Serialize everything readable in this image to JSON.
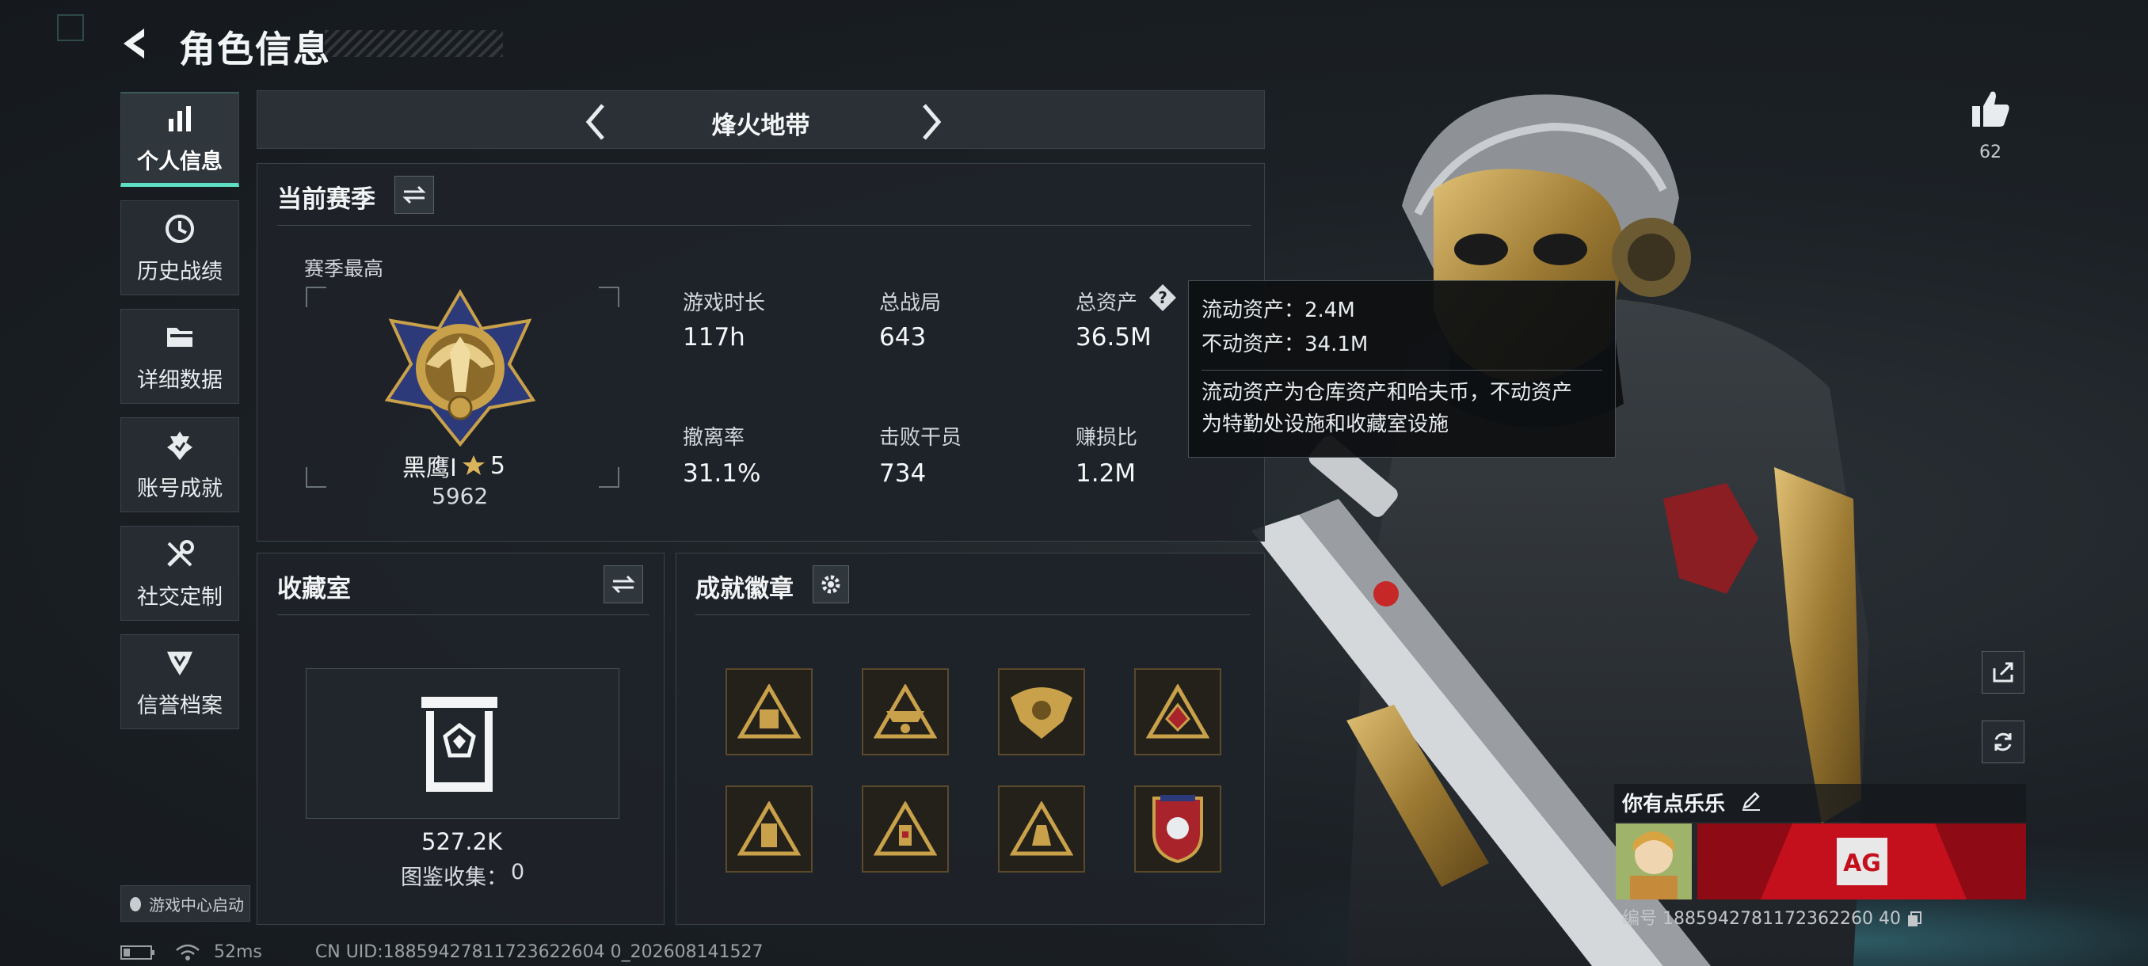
{
  "header": {
    "title": "角色信息"
  },
  "nav": {
    "items": [
      {
        "label": "个人信息",
        "icon": "bar-chart-icon",
        "active": true
      },
      {
        "label": "历史战绩",
        "icon": "history-clock-icon",
        "active": false
      },
      {
        "label": "详细数据",
        "icon": "folder-icon",
        "active": false
      },
      {
        "label": "账号成就",
        "icon": "achievement-icon",
        "active": false
      },
      {
        "label": "社交定制",
        "icon": "wrench-tools-icon",
        "active": false
      },
      {
        "label": "信誉档案",
        "icon": "credit-shield-icon",
        "active": false
      }
    ],
    "launch_label": "游戏中心启动"
  },
  "mode_selector": {
    "name": "烽火地带"
  },
  "season": {
    "title": "当前赛季",
    "peak_label": "赛季最高",
    "rank_name": "黑鹰I",
    "rank_stars": "5",
    "rank_points": "5962",
    "stats": [
      {
        "label": "游戏时长",
        "value": "117h"
      },
      {
        "label": "总战局",
        "value": "643"
      },
      {
        "label": "总资产",
        "value": "36.5M"
      },
      {
        "label": "撤离率",
        "value": "31.1%"
      },
      {
        "label": "击败干员",
        "value": "734"
      },
      {
        "label": "赚损比",
        "value": "1.2M"
      }
    ]
  },
  "tooltip": {
    "line1": "流动资产：2.4M",
    "line2": "不动资产：34.1M",
    "desc1": "流动资产为仓库资产和哈夫币，不动资产",
    "desc2": "为特勤处设施和收藏室设施"
  },
  "collection": {
    "title": "收藏室",
    "value": "527.2K",
    "catalog_label": "图鉴收集：",
    "catalog_value": "0"
  },
  "achievements": {
    "title": "成就徽章",
    "badges": [
      "badge-1",
      "badge-2",
      "badge-3",
      "badge-4",
      "badge-5",
      "badge-6",
      "badge-7",
      "badge-8"
    ]
  },
  "social": {
    "like_count": "62"
  },
  "player": {
    "name": "你有点乐乐",
    "id_label": "编号",
    "id_value": "1885942781172362260 40",
    "banner_text": "AG"
  },
  "status": {
    "ping": "52ms",
    "uid": "CN UID:18859427811723622604 0_202608141527"
  },
  "colors": {
    "accent": "#5de0c4",
    "gold": "#c9a14a",
    "banner_red": "#c4101c"
  }
}
